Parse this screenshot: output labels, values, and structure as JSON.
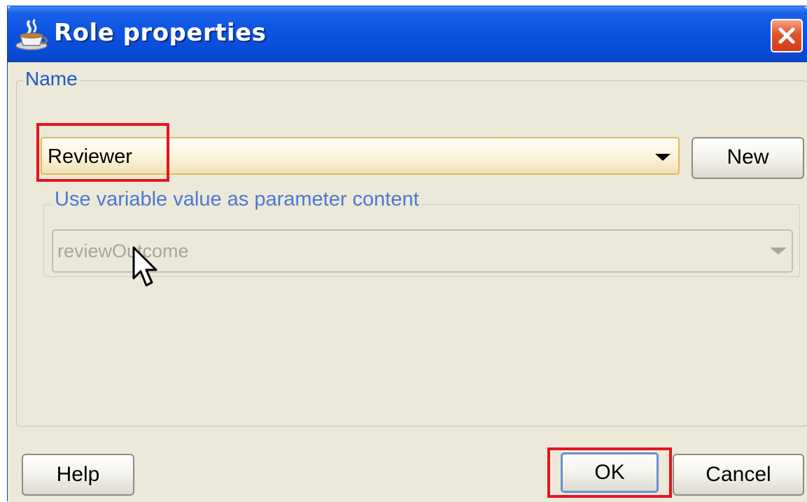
{
  "dialog": {
    "title": "Role properties",
    "icon": "coffee-cup-icon",
    "close_icon": "close-icon"
  },
  "name_group": {
    "legend": "Name",
    "selected_value": "Reviewer",
    "new_button": "New"
  },
  "variable_group": {
    "legend": "Use variable value as parameter content",
    "selected_value": "reviewOutcome",
    "enabled": false
  },
  "footer": {
    "help_button": "Help",
    "ok_button": "OK",
    "cancel_button": "Cancel"
  },
  "colors": {
    "titlebar": "#0c54e1",
    "dialog_background": "#ece9d8",
    "legend_text": "#2159c6",
    "highlight": "#e4151f",
    "close_button": "#e0532c"
  }
}
